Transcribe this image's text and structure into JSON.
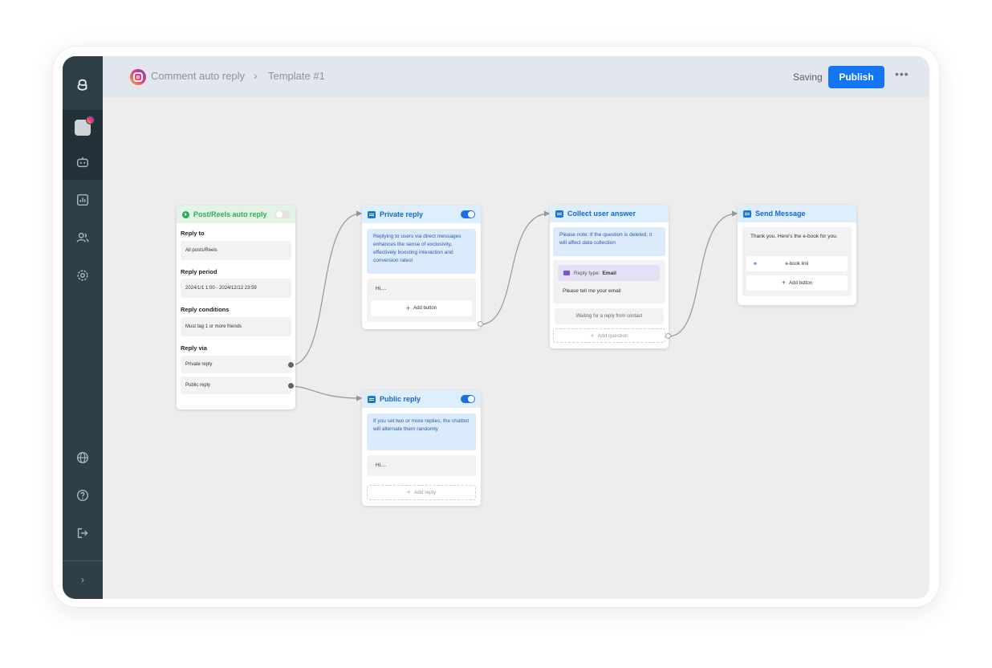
{
  "topbar": {
    "breadcrumb_1": "Comment auto reply",
    "breadcrumb_sep": "›",
    "breadcrumb_2": "Template #1",
    "status": "Saving",
    "publish_label": "Publish",
    "more_label": "•••"
  },
  "sidebar": {
    "icons": [
      "app-logo-icon",
      "instagram-account-icon",
      "chatbot-icon",
      "analytics-icon",
      "contacts-icon",
      "settings-icon",
      "language-icon",
      "help-icon",
      "logout-icon",
      "expand-icon"
    ],
    "expand_label": "›"
  },
  "nodes": {
    "trigger": {
      "title": "Post/Reels auto reply",
      "enabled": false,
      "reply_to_label": "Reply to",
      "reply_to_value": "All posts/Reels",
      "reply_period_label": "Reply period",
      "reply_period_value": "2024/1/1 1:00 - 2024/12/12 23:59",
      "reply_conditions_label": "Reply conditions",
      "reply_conditions_value": "Must tag 1 or more friends",
      "reply_via_label": "Reply via",
      "via_private": "Private reply",
      "via_public": "Public reply"
    },
    "private_reply": {
      "title": "Private reply",
      "enabled": true,
      "info": "Replying to users via direct messages enhances the sense of exclusivity, effectively boosting interaction and conversion rates!",
      "message": "Hi,...",
      "add_button": "Add button"
    },
    "public_reply": {
      "title": "Public reply",
      "enabled": true,
      "info": "If you set two or more replies, the chatbot will alternate them randomly",
      "message": "Hi,...",
      "add_reply": "Add reply"
    },
    "collect_answer": {
      "title": "Collect user answer",
      "info": "Please note: If the question is deleted, it will affect data collection",
      "reply_type_label": "Reply type:",
      "reply_type_value": "Email",
      "question": "Please tell me your email",
      "waiting": "Waiting for a reply from contact",
      "add_question": "Add question"
    },
    "send_message": {
      "title": "Send Message",
      "message": "Thank you. Here's the e-book for you.",
      "link_button": "e-book link",
      "add_button": "Add button"
    }
  },
  "colors": {
    "sidebar": "#2e3f47",
    "topbar": "#e2e7ee",
    "canvas": "#ededed",
    "accent": "#1475f5",
    "trigger_green": "#2fab55"
  }
}
